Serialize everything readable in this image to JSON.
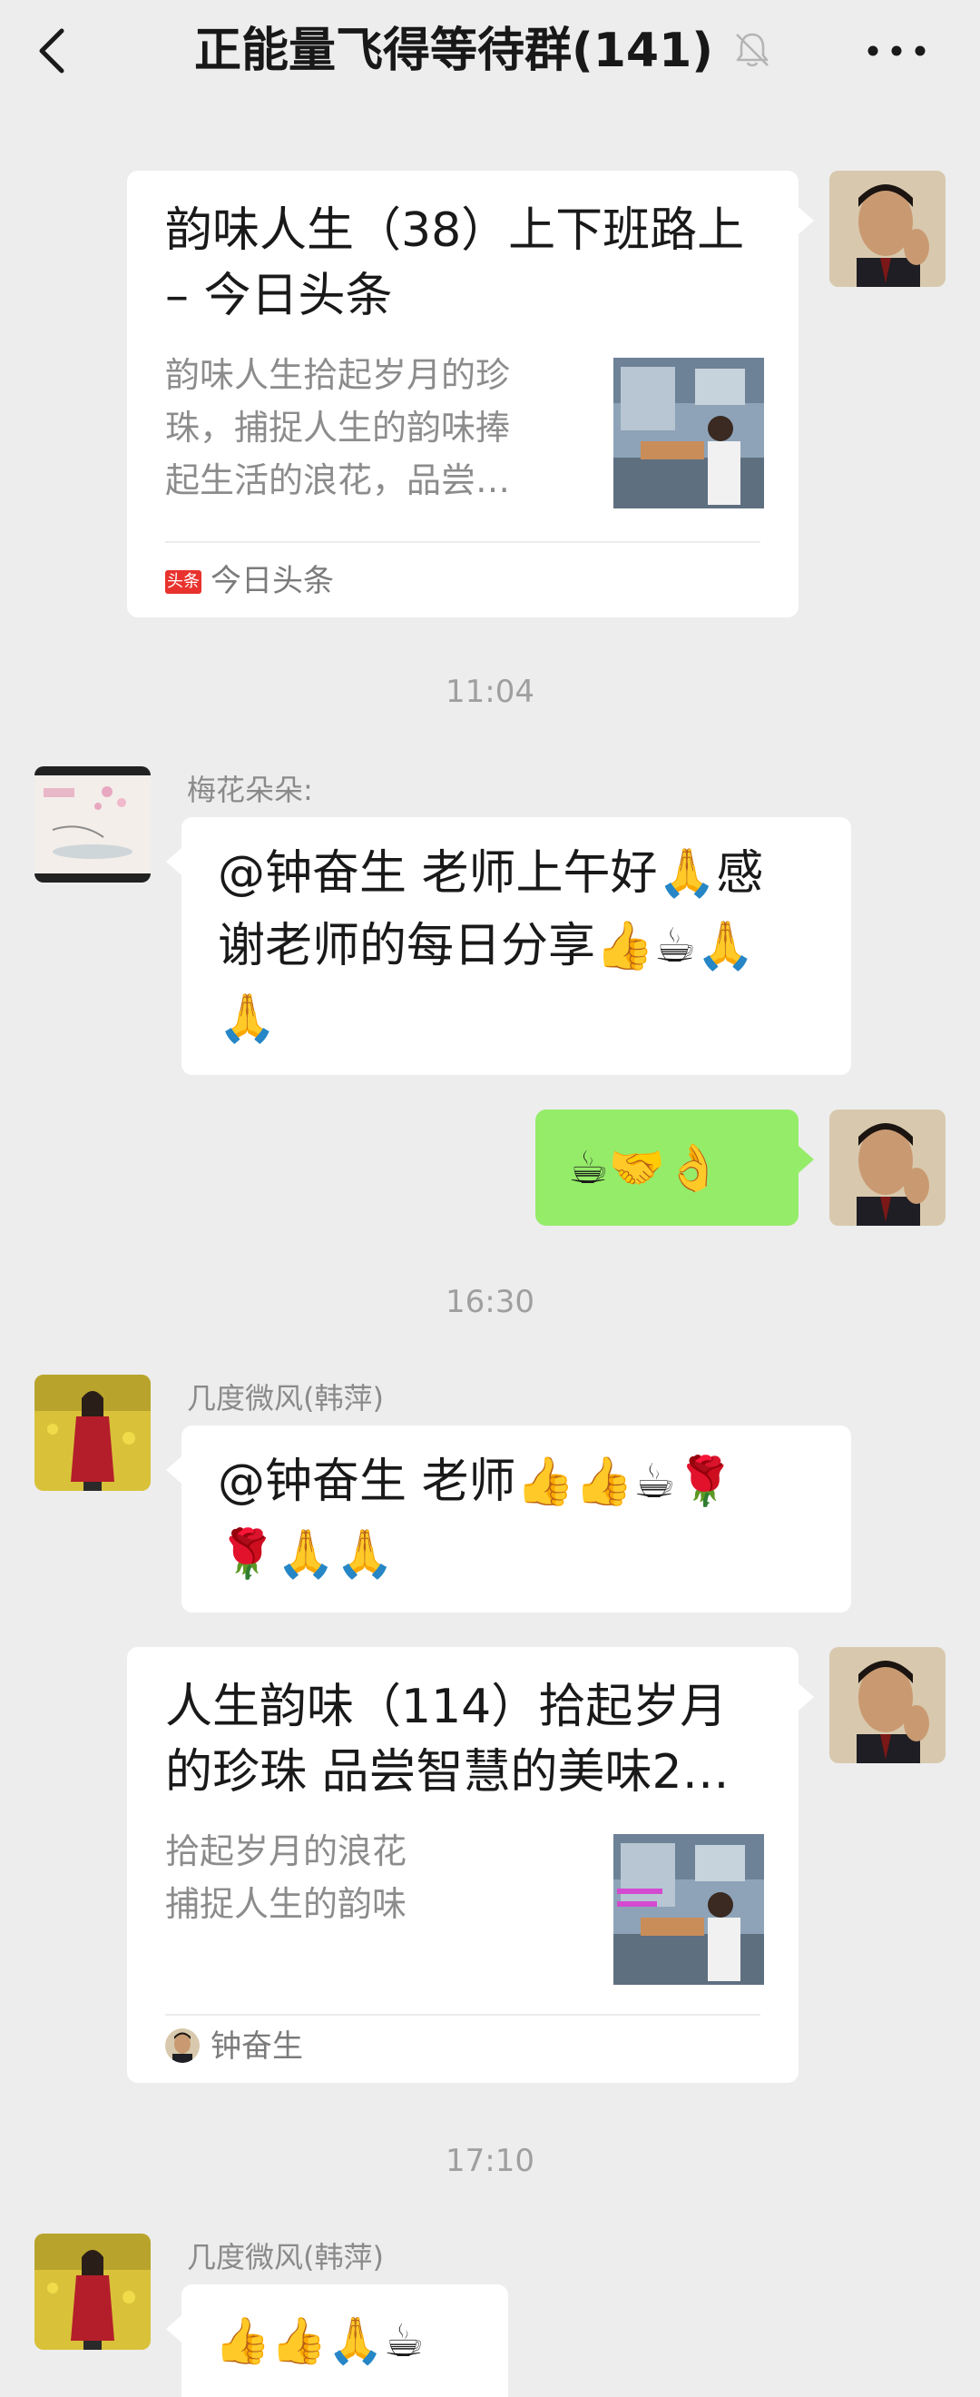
{
  "header": {
    "title": "正能量飞得等待群(141)",
    "back_icon": "back-arrow-icon",
    "mute_icon": "bell-muted-icon",
    "more_icon": "more-dots-icon"
  },
  "messages": {
    "card1": {
      "title_line1": "韵味人生（38）上下班路上",
      "title_line2": "– 今日头条",
      "desc_line1": "韵味人生拾起岁月的珍",
      "desc_line2": "珠，捕捉人生的韵味捧",
      "desc_line3": "起生活的浪花，品尝…",
      "source_badge": "头条",
      "source": "今日头条"
    },
    "time1": "11:04",
    "msg1": {
      "sender": "梅花朵朵:",
      "line1": "@钟奋生  老师上午好🙏感",
      "line2": "谢老师的每日分享👍☕🙏",
      "line3": "🙏"
    },
    "msg2": {
      "text": "☕🤝👌"
    },
    "time2": "16:30",
    "msg3": {
      "sender": "几度微风(韩萍)",
      "line1": "@钟奋生  老师👍👍☕🌹",
      "line2": "🌹🙏🙏"
    },
    "card2": {
      "title_line1": "人生韵味（114）拾起岁月",
      "title_line2": "的珍珠 品尝智慧的美味2…",
      "desc_line1": "拾起岁月的浪花",
      "desc_line2": "捕捉人生的韵味",
      "source": "钟奋生"
    },
    "time3": "17:10",
    "msg4": {
      "sender": "几度微风(韩萍)",
      "text": "👍👍🙏☕"
    }
  },
  "colors": {
    "background": "#ededed",
    "bubble_self": "#95ec69",
    "bubble_other": "#ffffff",
    "badge_red": "#e8322d"
  }
}
